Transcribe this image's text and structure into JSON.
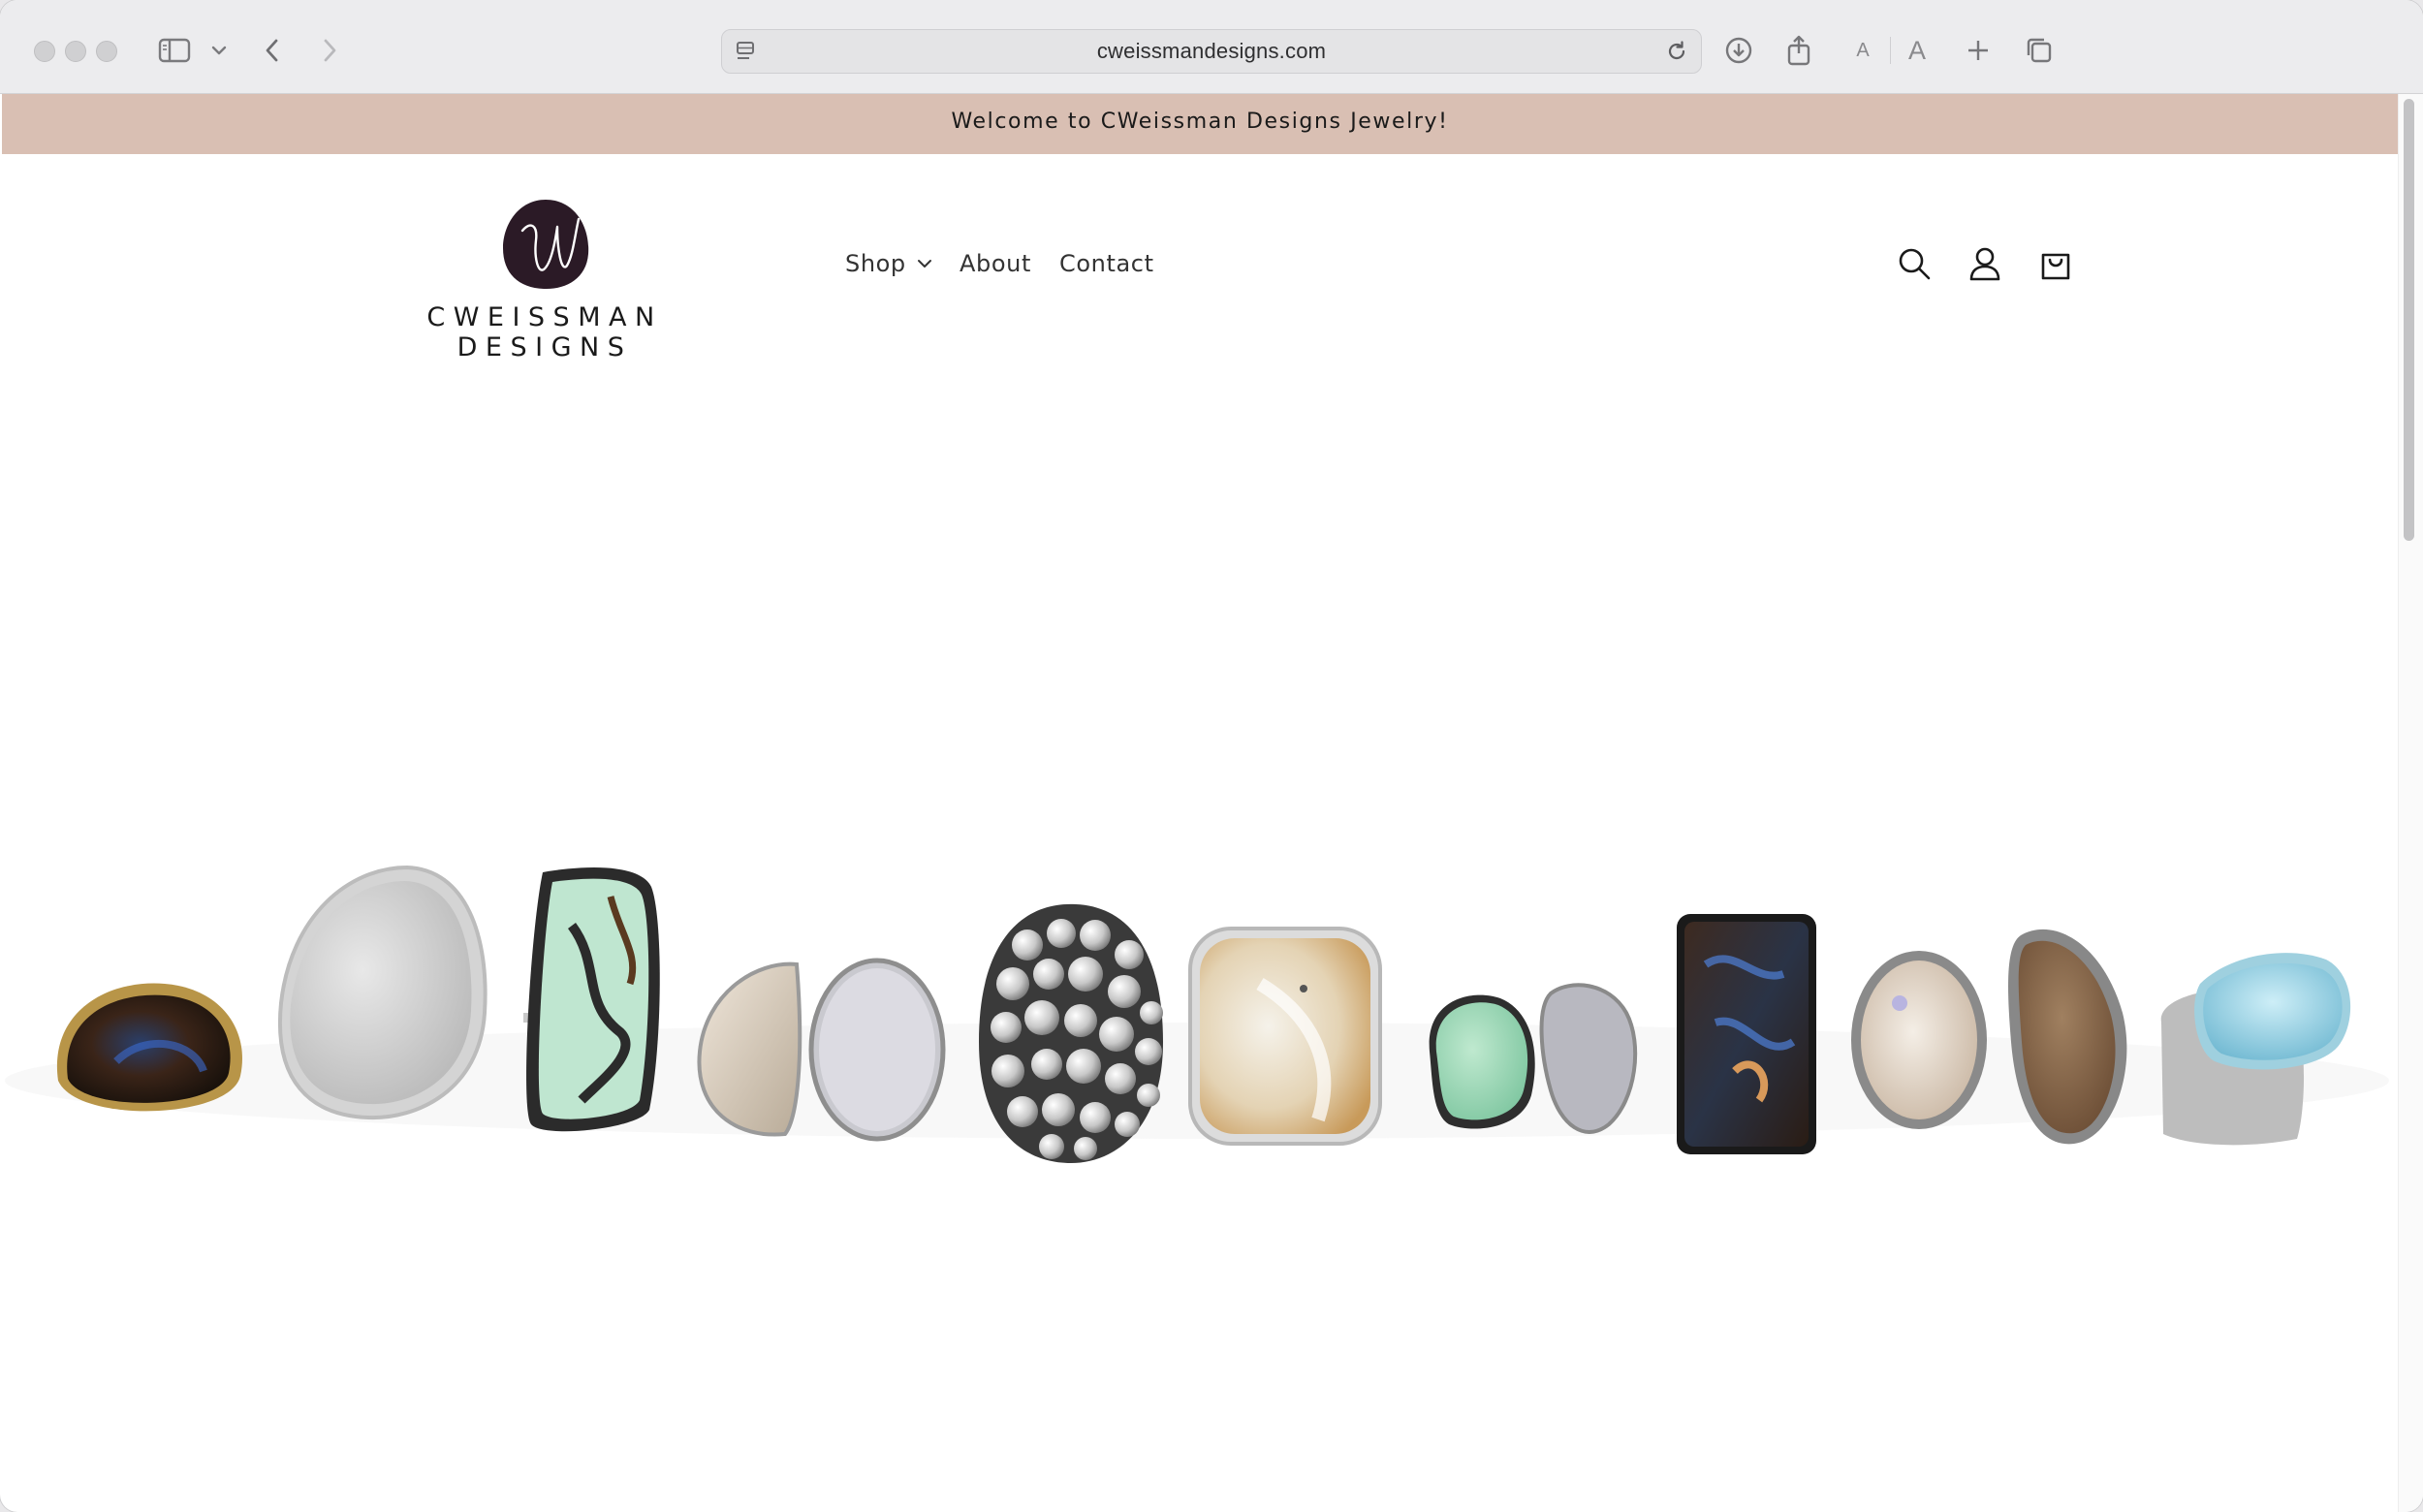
{
  "browser": {
    "url": "cweissmandesigns.com",
    "font_small_label": "A",
    "font_large_label": "A"
  },
  "announcement": {
    "text": "Welcome to CWeissman Designs Jewelry!",
    "background": "#d9bfb3"
  },
  "header": {
    "logo_text": "CWEISSMAN DESIGNS",
    "logo_color": "#2b1a26",
    "nav": [
      {
        "label": "Shop",
        "has_dropdown": true
      },
      {
        "label": "About"
      },
      {
        "label": "Contact"
      }
    ],
    "icons": [
      "search-icon",
      "account-icon",
      "cart-icon"
    ]
  },
  "hero": {
    "rings": [
      "boulder-opal-ring",
      "white-druzy-ring",
      "green-turquoise-ring",
      "jasper-and-druzy-ring",
      "silver-bubbles-ring",
      "agate-ring",
      "variscite-and-druzy-ring",
      "boulder-opal-rectangle-ring",
      "opal-and-druzy-ring",
      "larimar-ring"
    ]
  }
}
